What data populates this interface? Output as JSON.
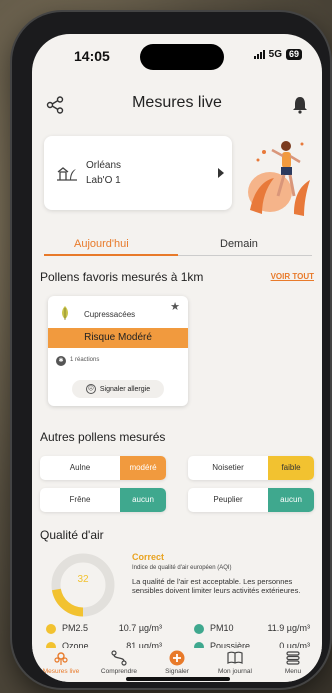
{
  "status_bar": {
    "time": "14:05",
    "network": "5G",
    "battery": "69"
  },
  "header": {
    "title": "Mesures live"
  },
  "location": {
    "city": "Orléans",
    "station": "Lab'O 1"
  },
  "tabs": [
    {
      "label": "Aujourd'hui",
      "active": true
    },
    {
      "label": "Demain",
      "active": false
    }
  ],
  "favorites": {
    "title": "Pollens favoris mesurés à 1km",
    "see_all": "VOIR TOUT",
    "card": {
      "name": "Cupressacées",
      "risk": "Risque Modéré",
      "risk_color": "#f19a3e",
      "reactions": "1 réactions",
      "button": "Signaler allergie"
    }
  },
  "others": {
    "title": "Autres pollens mesurés",
    "items": [
      {
        "name": "Aulne",
        "level": "modéré",
        "color": "#f19a3e"
      },
      {
        "name": "Noisetier",
        "level": "faible",
        "color": "#f2c230"
      },
      {
        "name": "Frêne",
        "level": "aucun",
        "color": "#3fa88e"
      },
      {
        "name": "Peuplier",
        "level": "aucun",
        "color": "#3fa88e"
      }
    ]
  },
  "air_quality": {
    "title": "Qualité d'air",
    "value": "32",
    "status": "Correct",
    "index_label": "Indice de qualité d'air européen (AQI)",
    "description": "La qualité de l'air est acceptable. Les personnes sensibles doivent limiter leurs activités extérieures.",
    "pollutants": [
      {
        "name": "PM2.5",
        "value": "10.7 µg/m³",
        "color": "#f2c230"
      },
      {
        "name": "PM10",
        "value": "11.9 µg/m³",
        "color": "#3fa88e"
      },
      {
        "name": "Ozone",
        "value": "81 µg/m³",
        "color": "#f2c230"
      },
      {
        "name": "Poussière",
        "value": "0 µg/m³",
        "color": "#3fa88e"
      }
    ]
  },
  "nav": [
    {
      "label": "Mesures live",
      "icon": "pollen-icon",
      "active": true
    },
    {
      "label": "Comprendre",
      "icon": "route-icon",
      "active": false
    },
    {
      "label": "Signaler",
      "icon": "plus-icon",
      "active": false
    },
    {
      "label": "Mon journal",
      "icon": "book-icon",
      "active": false
    },
    {
      "label": "Menu",
      "icon": "menu-icon",
      "active": false
    }
  ],
  "colors": {
    "accent": "#e87a2a",
    "moderate": "#f19a3e",
    "low": "#f2c230",
    "none": "#3fa88e"
  }
}
